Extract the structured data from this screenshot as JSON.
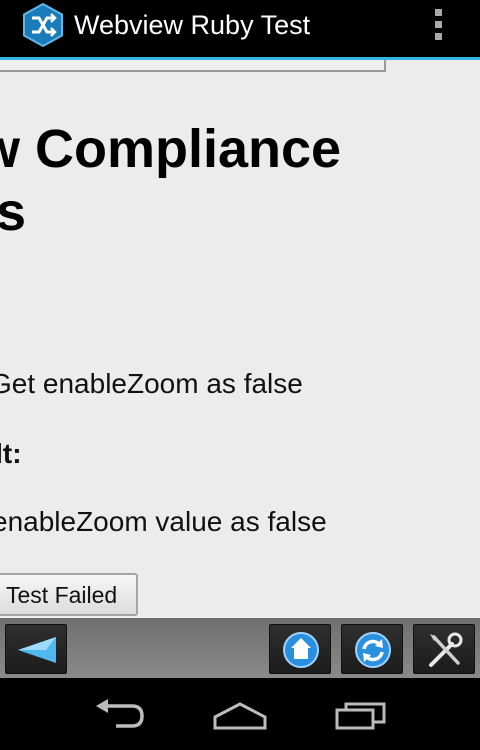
{
  "action_bar": {
    "title": "Webview Ruby Test",
    "app_icon": "hexagon-shuffle-icon",
    "overflow_icon": "overflow-menu-icon",
    "accent_color": "#33b5e5"
  },
  "content": {
    "heading_lines": [
      "w Compliance",
      "ts"
    ],
    "expected_line": "Get enableZoom as false",
    "result_label": "ult:",
    "actual_line": "enableZoom value as false",
    "test_button_label": "Test Failed"
  },
  "toolbar": {
    "back_icon": "blue-triangle-back-icon",
    "home_icon": "home-icon",
    "refresh_icon": "refresh-icon",
    "settings_icon": "tools-icon"
  },
  "navigation": {
    "back_icon": "back-nav-icon",
    "home_icon": "home-nav-icon",
    "recents_icon": "recents-nav-icon"
  }
}
